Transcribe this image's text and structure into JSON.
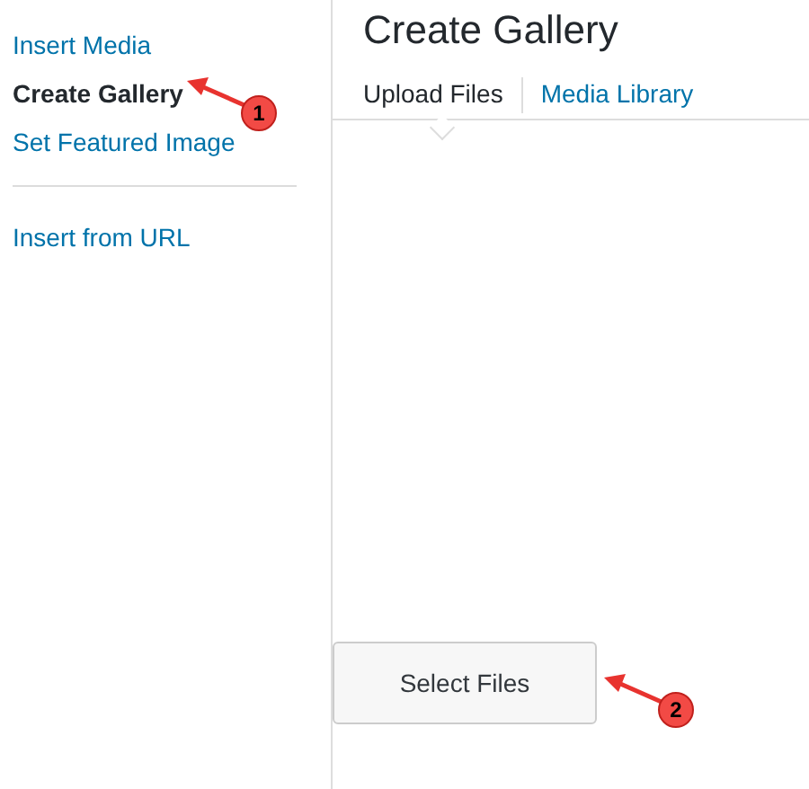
{
  "sidebar": {
    "groups": [
      [
        {
          "label": "Insert Media",
          "selected": false
        },
        {
          "label": "Create Gallery",
          "selected": true,
          "callout": "1"
        },
        {
          "label": "Set Featured Image",
          "selected": false
        }
      ],
      [
        {
          "label": "Insert from URL",
          "selected": false
        }
      ]
    ]
  },
  "title": "Create Gallery",
  "tabs": [
    {
      "label": "Upload Files",
      "selected": true
    },
    {
      "label": "Media Library",
      "selected": false
    }
  ],
  "upload": {
    "button": "Select Files",
    "callout": "2"
  }
}
